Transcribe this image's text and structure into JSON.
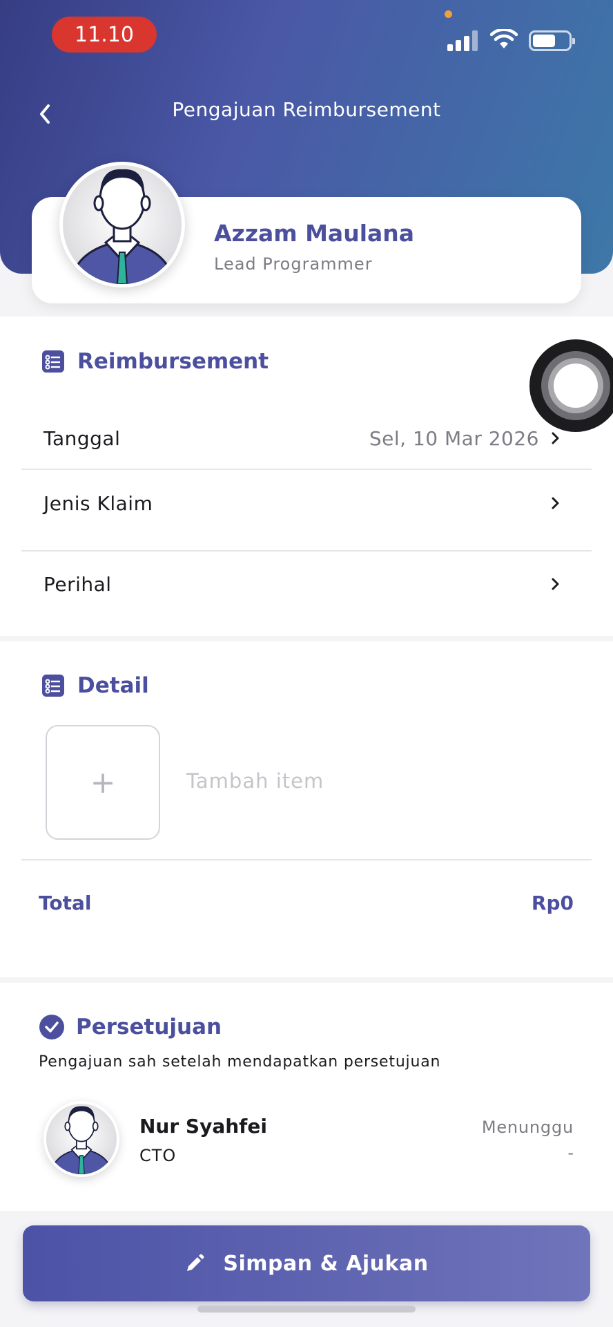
{
  "status_bar": {
    "time": "11.10"
  },
  "header": {
    "title": "Pengajuan Reimbursement"
  },
  "profile": {
    "name": "Azzam Maulana",
    "role": "Lead Programmer"
  },
  "reimbursement": {
    "title": "Reimbursement",
    "rows": [
      {
        "label": "Tanggal",
        "value": "Sel, 10 Mar 2026"
      },
      {
        "label": "Jenis Klaim",
        "value": ""
      },
      {
        "label": "Perihal",
        "value": ""
      }
    ]
  },
  "detail": {
    "title": "Detail",
    "add_symbol": "+",
    "add_label": "Tambah item",
    "total_label": "Total",
    "total_value": "Rp0"
  },
  "approval": {
    "title": "Persetujuan",
    "note": "Pengajuan sah setelah mendapatkan persetujuan",
    "approver": {
      "name": "Nur Syahfei",
      "role": "CTO",
      "status": "Menunggu",
      "date": "-"
    }
  },
  "submit": {
    "label": "Simpan & Ajukan"
  },
  "colors": {
    "primary": "#4b4f9e",
    "header_start": "#363d83",
    "header_end": "#3d78a8",
    "time_pill": "#d9362f"
  }
}
